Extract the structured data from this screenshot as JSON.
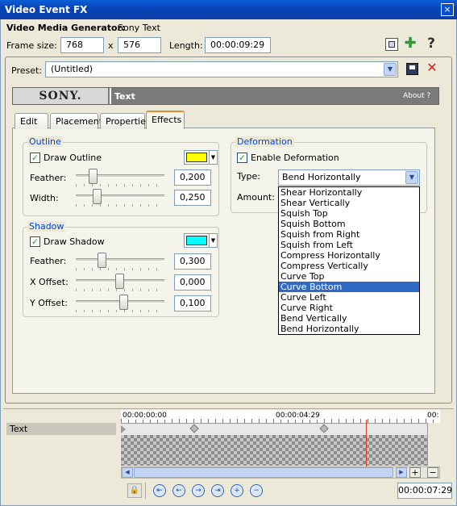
{
  "window": {
    "title": "Video Event FX",
    "close_label": "×"
  },
  "header": {
    "generator_label": "Video Media Generator:",
    "generator_value": "Sony Text",
    "frame_size_label": "Frame size:",
    "frame_width": "768",
    "x_label": "x",
    "frame_height": "576",
    "length_label": "Length:",
    "length_value": "00:00:09:29"
  },
  "preset": {
    "label": "Preset:",
    "value": "(Untitled)"
  },
  "plugin": {
    "brand": "SONY.",
    "name": "Text",
    "about": "About ?"
  },
  "tabs": [
    {
      "label": "Edit"
    },
    {
      "label": "Placement"
    },
    {
      "label": "Properties"
    },
    {
      "label": "Effects"
    }
  ],
  "outline": {
    "title": "Outline",
    "draw_label": "Draw Outline",
    "draw_checked": true,
    "color": "#ffff00",
    "feather_label": "Feather:",
    "feather_value": "0,200",
    "width_label": "Width:",
    "width_value": "0,250"
  },
  "shadow": {
    "title": "Shadow",
    "draw_label": "Draw Shadow",
    "draw_checked": true,
    "color": "#00ffff",
    "feather_label": "Feather:",
    "feather_value": "0,300",
    "xoffset_label": "X Offset:",
    "xoffset_value": "0,000",
    "yoffset_label": "Y Offset:",
    "yoffset_value": "0,100"
  },
  "deformation": {
    "title": "Deformation",
    "enable_label": "Enable Deformation",
    "enable_checked": true,
    "type_label": "Type:",
    "type_value": "Bend Horizontally",
    "amount_label": "Amount:",
    "options": [
      "Shear Horizontally",
      "Shear Vertically",
      "Squish Top",
      "Squish Bottom",
      "Squish from Right",
      "Squish from Left",
      "Compress Horizontally",
      "Compress Vertically",
      "Curve Top",
      "Curve Bottom",
      "Curve Left",
      "Curve Right",
      "Bend Vertically",
      "Bend Horizontally"
    ],
    "highlighted": "Curve Bottom"
  },
  "timeline": {
    "track_label": "Text",
    "ruler_start": "00:00:00:00",
    "ruler_mid": "00:00:04:29",
    "ruler_end": "00:",
    "current_time": "00:00:07:29"
  },
  "colors": {
    "highlight": "#316ac5",
    "group_title": "#0046d5",
    "playhead": "#e04010"
  }
}
